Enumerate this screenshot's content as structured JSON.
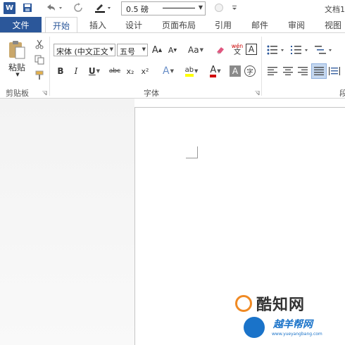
{
  "app": {
    "logo_letter": "W",
    "doc_title": "文档1"
  },
  "qat": {
    "border_weight": "0.5 磅"
  },
  "tabs": {
    "file": "文件",
    "items": [
      "开始",
      "插入",
      "设计",
      "页面布局",
      "引用",
      "邮件",
      "审阅",
      "视图"
    ]
  },
  "clipboard": {
    "paste_label": "粘贴",
    "group_label": "剪贴板"
  },
  "font": {
    "family": "宋体 (中文正文)",
    "size": "五号",
    "group_label": "字体",
    "grow": "A",
    "shrink": "A",
    "case_label": "Aa",
    "wen_label": "wén",
    "wen_char": "文",
    "border_char": "A",
    "bold": "B",
    "italic": "I",
    "underline": "U",
    "strike": "abc",
    "subscript": "x₂",
    "superscript": "x²",
    "effects_char": "A",
    "highlight_char": "ab",
    "color_char": "A",
    "shade_char": "A",
    "enclose_char": "字"
  },
  "paragraph": {
    "group_label_partial": "段"
  },
  "watermarks": {
    "brand1": "酷知网",
    "brand2": "越羊帮网",
    "brand2_url": "www.yueyangbang.com"
  },
  "colors": {
    "accent": "#2b579a",
    "highlight": "#ffff00",
    "font_color": "#d00000",
    "brand_orange": "#f08a24",
    "brand_blue": "#1a73c9"
  }
}
